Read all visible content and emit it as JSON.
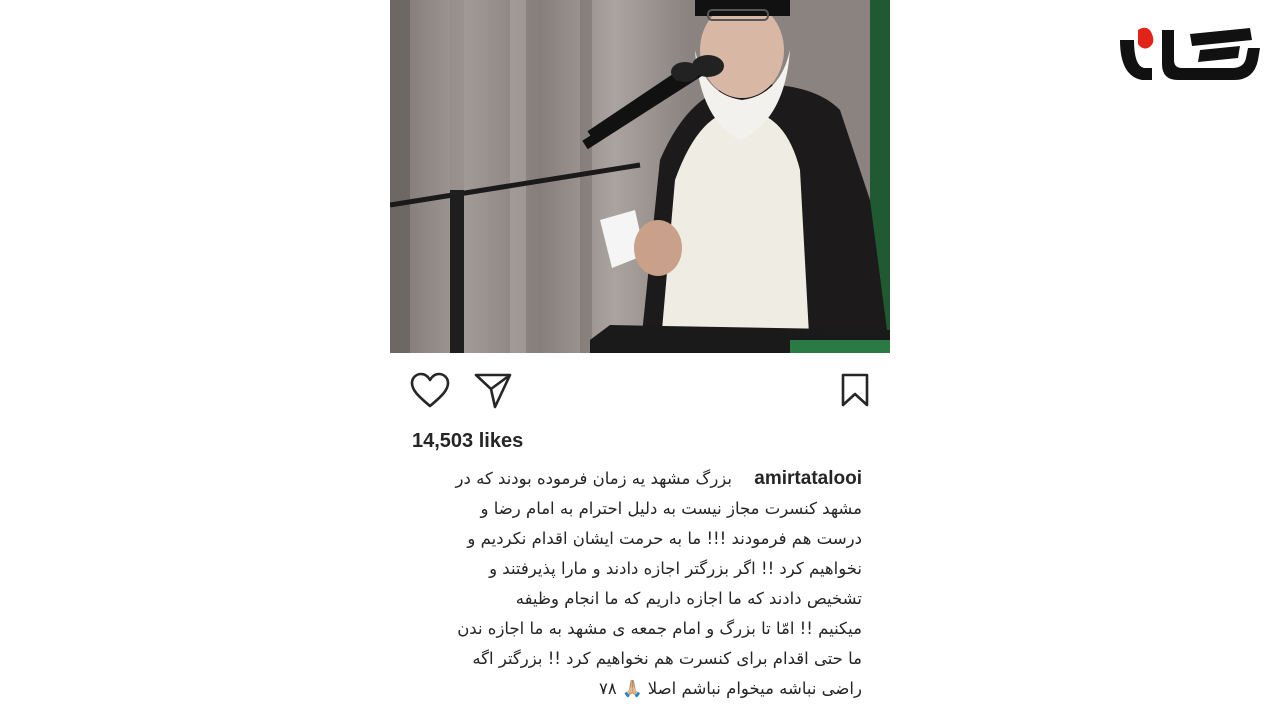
{
  "post": {
    "likes_text": "14,503 likes",
    "username": "amirtatalooi",
    "caption_lines": [
      "بزرگ مشهد یه زمان فرموده بودند که در",
      "مشهد کنسرت مجاز نیست به دلیل احترام به امام رضا و",
      "درست هم فرمودند !!! ما به حرمت ایشان اقدام نکردیم و",
      "نخواهیم کرد !! اگر بزرگتر اجازه دادند و مارا پذیرفتند و",
      "تشخیص دادند که ما اجازه داریم که ما انجام وظیفه",
      "میکنیم !! امّا تا بزرگ و امام جمعه ی مشهد به ما اجازه ندن",
      "ما حتی اقدام برای کنسرت هم نخواهیم کرد !! بزرگتر اگه",
      "راضی نباشه میخوام نباشم اصلا 🙏🏼 ۷۸"
    ]
  },
  "icons": {
    "like": "heart-outline-icon",
    "share": "paper-plane-icon",
    "save": "bookmark-outline-icon"
  },
  "colors": {
    "text": "#262626",
    "logo_red": "#e2231a",
    "logo_black": "#111111"
  }
}
